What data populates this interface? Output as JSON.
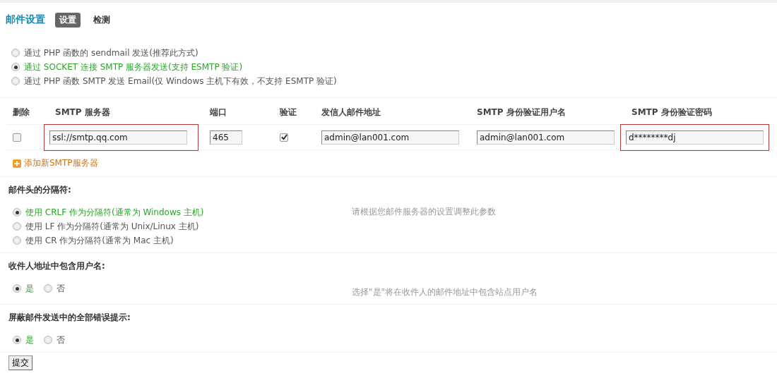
{
  "header": {
    "title": "邮件设置",
    "tabs": [
      {
        "label": "设置",
        "selected": true
      },
      {
        "label": "检测",
        "selected": false
      }
    ]
  },
  "send_methods": [
    {
      "label": "通过 PHP 函数的 sendmail 发送(推荐此方式)",
      "selected": false
    },
    {
      "label": "通过 SOCKET 连接 SMTP 服务器发送(支持 ESMTP 验证)",
      "selected": true
    },
    {
      "label": "通过 PHP 函数 SMTP 发送 Email(仅 Windows 主机下有效，不支持 ESMTP 验证)",
      "selected": false
    }
  ],
  "smtp_table": {
    "columns": [
      "删除",
      "SMTP 服务器",
      "端口",
      "验证",
      "发信人邮件地址",
      "SMTP 身份验证用户名",
      "SMTP 身份验证密码"
    ],
    "rows": [
      {
        "delete_checked": false,
        "server": "ssl://smtp.qq.com",
        "server_highlighted": true,
        "port": "465",
        "auth_checked": true,
        "sender": "admin@lan001.com",
        "username": "admin@lan001.com",
        "password": "d********dj",
        "password_highlighted": true
      }
    ],
    "add_link": "添加新SMTP服务器"
  },
  "sections": [
    {
      "label": "邮件头的分隔符:",
      "hint": "请根据您邮件服务器的设置调整此参数",
      "kind": "stacked",
      "options": [
        {
          "label": "使用 CRLF 作为分隔符(通常为 Windows 主机)",
          "selected": true
        },
        {
          "label": "使用 LF 作为分隔符(通常为 Unix/Linux 主机)",
          "selected": false
        },
        {
          "label": "使用 CR 作为分隔符(通常为 Mac 主机)",
          "selected": false
        }
      ]
    },
    {
      "label": "收件人地址中包含用户名:",
      "hint": "选择\"是\"将在收件人的邮件地址中包含站点用户名",
      "kind": "inline",
      "options": [
        {
          "label": "是",
          "selected": true
        },
        {
          "label": "否",
          "selected": false
        }
      ]
    },
    {
      "label": "屏蔽邮件发送中的全部错误提示:",
      "kind": "inline",
      "options": [
        {
          "label": "是",
          "selected": true
        },
        {
          "label": "否",
          "selected": false
        }
      ]
    }
  ],
  "submit": "提交"
}
